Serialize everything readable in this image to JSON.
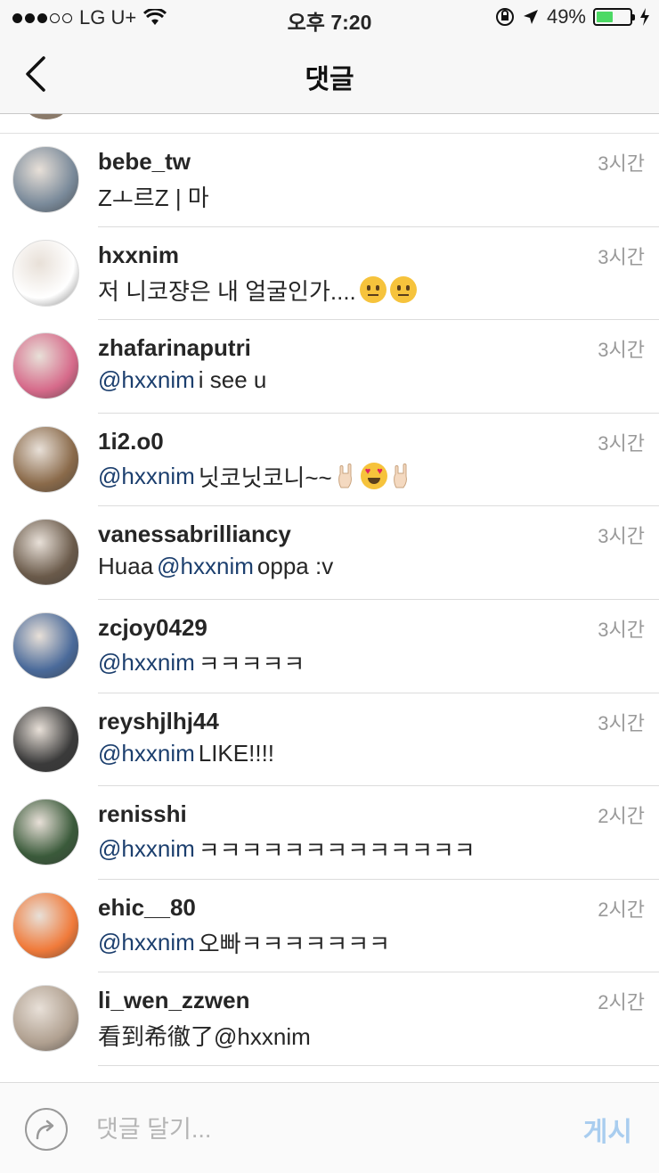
{
  "status_bar": {
    "carrier": "LG U+",
    "time": "오후 7:20",
    "battery": "49%",
    "battery_level": 0.49,
    "signal_bars": 3
  },
  "nav": {
    "title": "댓글",
    "back_icon": "chevron-left-icon"
  },
  "comments": [
    {
      "username": "bebe_tw",
      "time": "3시간",
      "mention": "",
      "text": "Zㅗ르Z | 마",
      "avatar_color": "#7a8a9a"
    },
    {
      "username": "hxxnim",
      "time": "3시간",
      "mention": "",
      "text": "저 니코쟝은 내 얼굴인가....",
      "emojis": [
        "neutral-face",
        "neutral-face"
      ],
      "avatar_color": "#ffffff"
    },
    {
      "username": "zhafarinaputri",
      "time": "3시간",
      "mention": "@hxxnim",
      "text": "i see u",
      "avatar_color": "#d66a8a"
    },
    {
      "username": "1i2.o0",
      "time": "3시간",
      "mention": "@hxxnim",
      "text": "닛코닛코니~~",
      "emojis": [
        "rock-hand",
        "heart-eyes",
        "rock-hand"
      ],
      "avatar_color": "#8a6a4a"
    },
    {
      "username": "vanessabrilliancy",
      "time": "3시간",
      "mention": "",
      "text_prefix": "Huaa",
      "text_mention": "@hxxnim",
      "text": "oppa :v",
      "avatar_color": "#6a5a4a"
    },
    {
      "username": "zcjoy0429",
      "time": "3시간",
      "mention": "@hxxnim",
      "text": "ㅋㅋㅋㅋㅋ",
      "avatar_color": "#4a6a9a"
    },
    {
      "username": "reyshjlhj44",
      "time": "3시간",
      "mention": "@hxxnim",
      "text": "LIKE!!!!",
      "avatar_color": "#3a3a3a"
    },
    {
      "username": "renisshi",
      "time": "2시간",
      "mention": "@hxxnim",
      "text": "ㅋㅋㅋㅋㅋㅋㅋㅋㅋㅋㅋㅋㅋ",
      "avatar_color": "#3a5a3a"
    },
    {
      "username": "ehic__80",
      "time": "2시간",
      "mention": "@hxxnim",
      "text": "오빠ㅋㅋㅋㅋㅋㅋㅋ",
      "avatar_color": "#f07a3a"
    },
    {
      "username": "li_wen_zzwen",
      "time": "2시간",
      "mention": "",
      "text": "看到希徹了@hxxnim",
      "avatar_color": "#b0a090"
    }
  ],
  "bottom": {
    "placeholder": "댓글 달기...",
    "post_label": "게시",
    "share_icon": "reply-arrow-icon"
  },
  "colors": {
    "mention": "#1c3f6e",
    "time": "#999999",
    "post_disabled": "#a9cdef"
  }
}
